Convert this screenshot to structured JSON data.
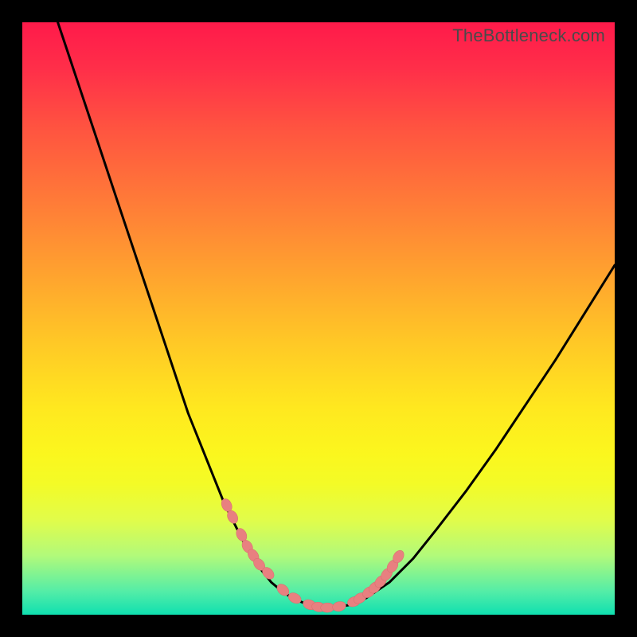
{
  "watermark": "TheBottleneck.com",
  "chart_data": {
    "type": "line",
    "title": "",
    "xlabel": "",
    "ylabel": "",
    "xlim": [
      0,
      100
    ],
    "ylim": [
      0,
      100
    ],
    "grid": false,
    "legend": false,
    "series": [
      {
        "name": "curve",
        "type": "line",
        "x": [
          6,
          8,
          10,
          12,
          14,
          16,
          18,
          20,
          22,
          24,
          26,
          28,
          30,
          32,
          34,
          36,
          38,
          40,
          42,
          44,
          46,
          48,
          50,
          52,
          55,
          58,
          62,
          66,
          70,
          75,
          80,
          85,
          90,
          95,
          100
        ],
        "y": [
          100,
          94,
          88,
          82,
          76,
          70,
          64,
          58,
          52,
          46,
          40,
          34,
          29,
          24,
          19,
          15,
          11,
          8,
          5.5,
          3.8,
          2.6,
          1.8,
          1.3,
          1.2,
          1.6,
          2.8,
          5.5,
          9.5,
          14.5,
          21,
          28,
          35.5,
          43,
          51,
          59
        ]
      },
      {
        "name": "beads",
        "type": "scatter",
        "x": [
          34.5,
          35.5,
          37,
          38,
          39,
          40,
          41.5,
          44,
          46,
          48.5,
          50,
          51.5,
          53.5,
          56,
          57,
          58.5,
          59.5,
          60.5,
          61.5,
          62.5,
          63.5
        ],
        "y": [
          18.5,
          16.5,
          13.5,
          11.5,
          10,
          8.5,
          7,
          4.2,
          2.8,
          1.7,
          1.3,
          1.2,
          1.4,
          2.2,
          2.8,
          3.8,
          4.6,
          5.6,
          6.8,
          8.2,
          9.8
        ]
      }
    ]
  },
  "colors": {
    "curve": "#000000",
    "beads": "#e88080"
  }
}
